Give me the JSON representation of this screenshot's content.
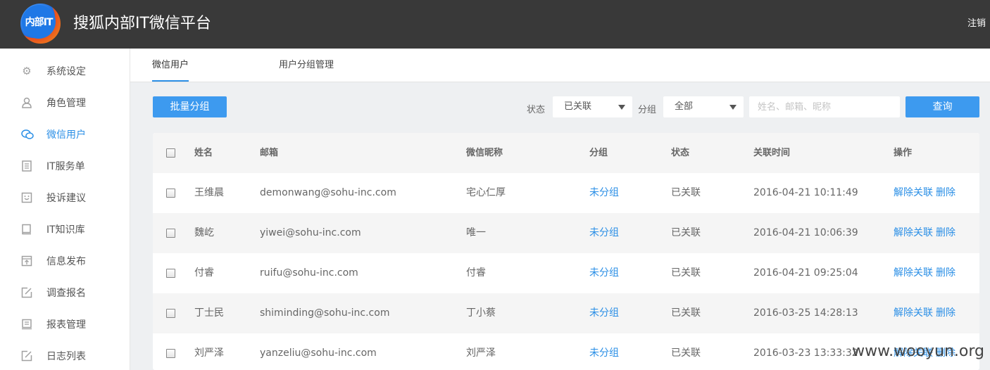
{
  "header": {
    "logo_text": "内部IT",
    "title": "搜狐内部IT微信平台",
    "logout": "注销"
  },
  "sidebar": {
    "items": [
      {
        "label": "系统设定",
        "icon": "gear-icon"
      },
      {
        "label": "角色管理",
        "icon": "user-icon"
      },
      {
        "label": "微信用户",
        "icon": "wechat-icon"
      },
      {
        "label": "IT服务单",
        "icon": "document-icon"
      },
      {
        "label": "投诉建议",
        "icon": "feedback-icon"
      },
      {
        "label": "IT知识库",
        "icon": "book-icon"
      },
      {
        "label": "信息发布",
        "icon": "publish-icon"
      },
      {
        "label": "调查报名",
        "icon": "edit-icon"
      },
      {
        "label": "报表管理",
        "icon": "report-icon"
      },
      {
        "label": "日志列表",
        "icon": "log-icon"
      }
    ],
    "active_index": 2
  },
  "tabs": [
    {
      "label": "微信用户"
    },
    {
      "label": "用户分组管理"
    }
  ],
  "toolbar": {
    "batch_group": "批量分组",
    "status_label": "状态",
    "status_value": "已关联",
    "group_label": "分组",
    "group_value": "全部",
    "search_placeholder": "姓名、邮箱、昵称",
    "query_button": "查询"
  },
  "table": {
    "headers": [
      "姓名",
      "邮箱",
      "微信昵称",
      "分组",
      "状态",
      "关联时间",
      "操作"
    ],
    "rows": [
      {
        "name": "王维晨",
        "email": "demonwang@sohu-inc.com",
        "nickname": "宅心仁厚",
        "group": "未分组",
        "status": "已关联",
        "time": "2016-04-21 10:11:49"
      },
      {
        "name": "魏屹",
        "email": "yiwei@sohu-inc.com",
        "nickname": "唯一",
        "group": "未分组",
        "status": "已关联",
        "time": "2016-04-21 10:06:39"
      },
      {
        "name": "付睿",
        "email": "ruifu@sohu-inc.com",
        "nickname": "付睿",
        "group": "未分组",
        "status": "已关联",
        "time": "2016-04-21 09:25:04"
      },
      {
        "name": "丁士民",
        "email": "shiminding@sohu-inc.com",
        "nickname": "丁小蔡",
        "group": "未分组",
        "status": "已关联",
        "time": "2016-03-25 14:28:13"
      },
      {
        "name": "刘严泽",
        "email": "yanzeliu@sohu-inc.com",
        "nickname": "刘严泽",
        "group": "未分组",
        "status": "已关联",
        "time": "2016-03-23 13:33:32"
      }
    ],
    "action_unlink": "解除关联",
    "action_delete": "删除"
  },
  "watermark": "www.wooyun.org",
  "colors": {
    "topbar": "#393939",
    "accent": "#2b8fe6",
    "button": "#3d9aef"
  }
}
